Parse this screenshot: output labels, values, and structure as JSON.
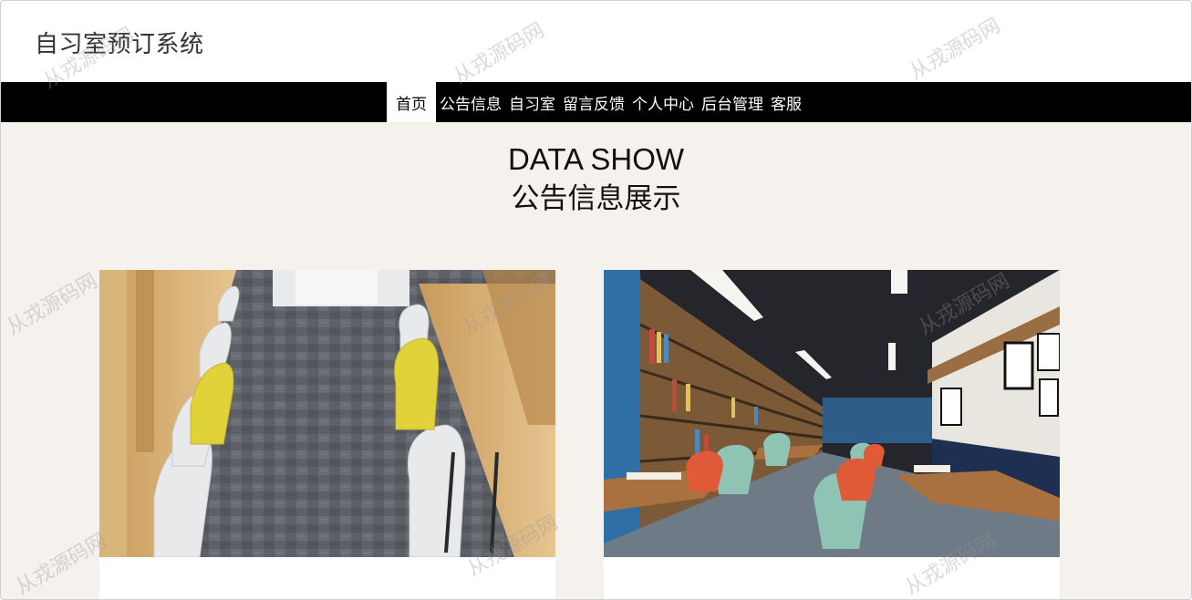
{
  "site": {
    "title": "自习室预订系统"
  },
  "nav": {
    "items": [
      {
        "label": "首页",
        "active": true
      },
      {
        "label": "公告信息",
        "active": false
      },
      {
        "label": "自习室",
        "active": false
      },
      {
        "label": "留言反馈",
        "active": false
      },
      {
        "label": "个人中心",
        "active": false
      },
      {
        "label": "后台管理",
        "active": false
      },
      {
        "label": "客服",
        "active": false
      }
    ]
  },
  "section": {
    "title_en": "DATA SHOW",
    "title_cn": "公告信息展示"
  },
  "cards": [
    {
      "image": "study-room-photo-white-chairs",
      "caption": ""
    },
    {
      "image": "library-cafe-photo-bookshelves",
      "caption": ""
    }
  ],
  "watermark": {
    "text": "从戎源码网"
  },
  "colors": {
    "page_bg": "#f5f1ed",
    "nav_bg": "#000000",
    "nav_text": "#ffffff",
    "nav_active_bg": "#ffffff"
  }
}
